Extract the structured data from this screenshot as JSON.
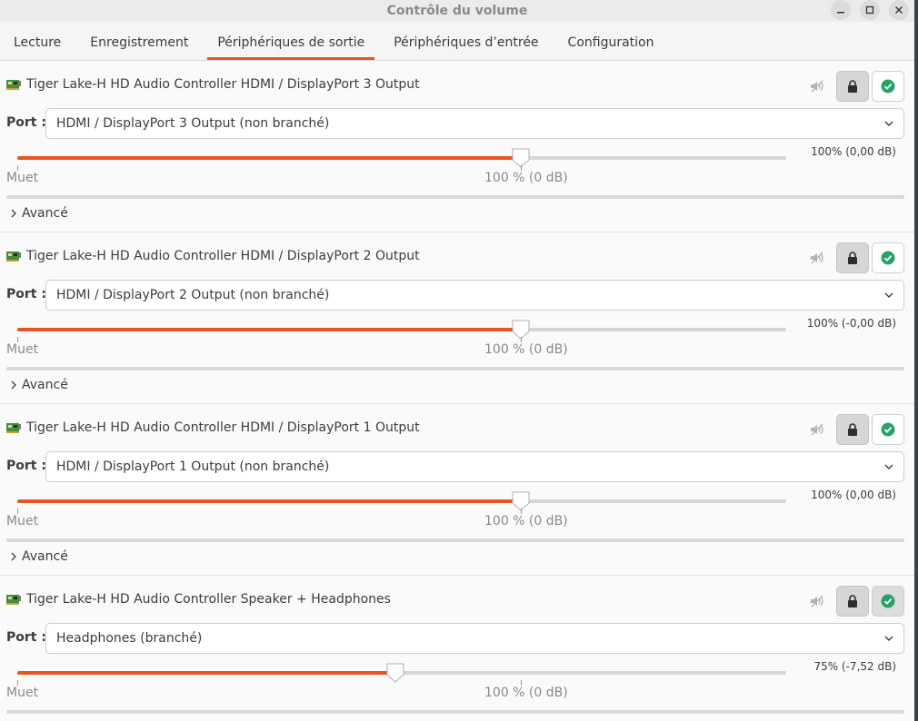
{
  "window": {
    "title": "Contrôle du volume"
  },
  "tabs": [
    {
      "label": "Lecture"
    },
    {
      "label": "Enregistrement"
    },
    {
      "label": "Périphériques de sortie"
    },
    {
      "label": "Périphériques d’entrée"
    },
    {
      "label": "Configuration"
    }
  ],
  "active_tab": 2,
  "accent_color": "#e95420",
  "port_label": "Port :",
  "advanced_label": "Avancé",
  "scale": {
    "min_label": "Muet",
    "mid_label": "100 % (0 dB)"
  },
  "devices": [
    {
      "name": "Tiger Lake-H HD Audio Controller HDMI / DisplayPort 3 Output",
      "port": "HDMI / DisplayPort 3 Output (non branché)",
      "volume_percent": 100,
      "readout": "100% (0,00 dB)",
      "is_default": false,
      "show_advanced": true
    },
    {
      "name": "Tiger Lake-H HD Audio Controller HDMI / DisplayPort 2 Output",
      "port": "HDMI / DisplayPort 2 Output (non branché)",
      "volume_percent": 100,
      "readout": "100% (-0,00 dB)",
      "is_default": false,
      "show_advanced": true
    },
    {
      "name": "Tiger Lake-H HD Audio Controller HDMI / DisplayPort 1 Output",
      "port": "HDMI / DisplayPort 1 Output (non branché)",
      "volume_percent": 100,
      "readout": "100% (0,00 dB)",
      "is_default": false,
      "show_advanced": true
    },
    {
      "name": "Tiger Lake-H HD Audio Controller Speaker + Headphones",
      "port": "Headphones (branché)",
      "volume_percent": 75,
      "readout": "75% (-7,52 dB)",
      "is_default": true,
      "show_advanced": false
    }
  ]
}
